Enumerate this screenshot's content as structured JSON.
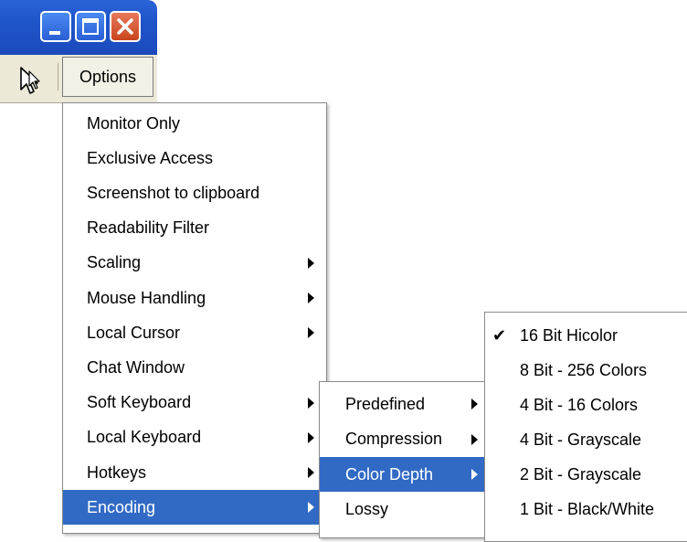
{
  "window": {
    "minimize_label": "Minimize",
    "maximize_label": "Maximize",
    "close_label": "Close"
  },
  "toolbar": {
    "options_label": "Options"
  },
  "options_menu": {
    "items": [
      {
        "label": "Monitor Only",
        "submenu": false
      },
      {
        "label": "Exclusive Access",
        "submenu": false
      },
      {
        "label": "Screenshot to clipboard",
        "submenu": false
      },
      {
        "label": "Readability Filter",
        "submenu": false
      },
      {
        "label": "Scaling",
        "submenu": true
      },
      {
        "label": "Mouse Handling",
        "submenu": true
      },
      {
        "label": "Local Cursor",
        "submenu": true
      },
      {
        "label": "Chat Window",
        "submenu": false
      },
      {
        "label": "Soft Keyboard",
        "submenu": true
      },
      {
        "label": "Local Keyboard",
        "submenu": true
      },
      {
        "label": "Hotkeys",
        "submenu": true
      },
      {
        "label": "Encoding",
        "submenu": true,
        "selected": true
      }
    ]
  },
  "encoding_menu": {
    "items": [
      {
        "label": "Predefined",
        "submenu": true
      },
      {
        "label": "Compression",
        "submenu": true
      },
      {
        "label": "Color Depth",
        "submenu": true,
        "selected": true
      },
      {
        "label": "Lossy",
        "submenu": false
      }
    ]
  },
  "color_depth_menu": {
    "checkmark": "✔",
    "items": [
      {
        "label": "16 Bit Hicolor",
        "checked": true
      },
      {
        "label": "8 Bit - 256 Colors",
        "checked": false
      },
      {
        "label": "4 Bit - 16 Colors",
        "checked": false
      },
      {
        "label": "4 Bit - Grayscale",
        "checked": false
      },
      {
        "label": "2 Bit - Grayscale",
        "checked": false
      },
      {
        "label": "1 Bit - Black/White",
        "checked": false
      }
    ]
  },
  "colors": {
    "titlebar": "#1f54c9",
    "selection": "#316ac5",
    "close_button": "#c8441d",
    "toolbar": "#ece9d8"
  }
}
